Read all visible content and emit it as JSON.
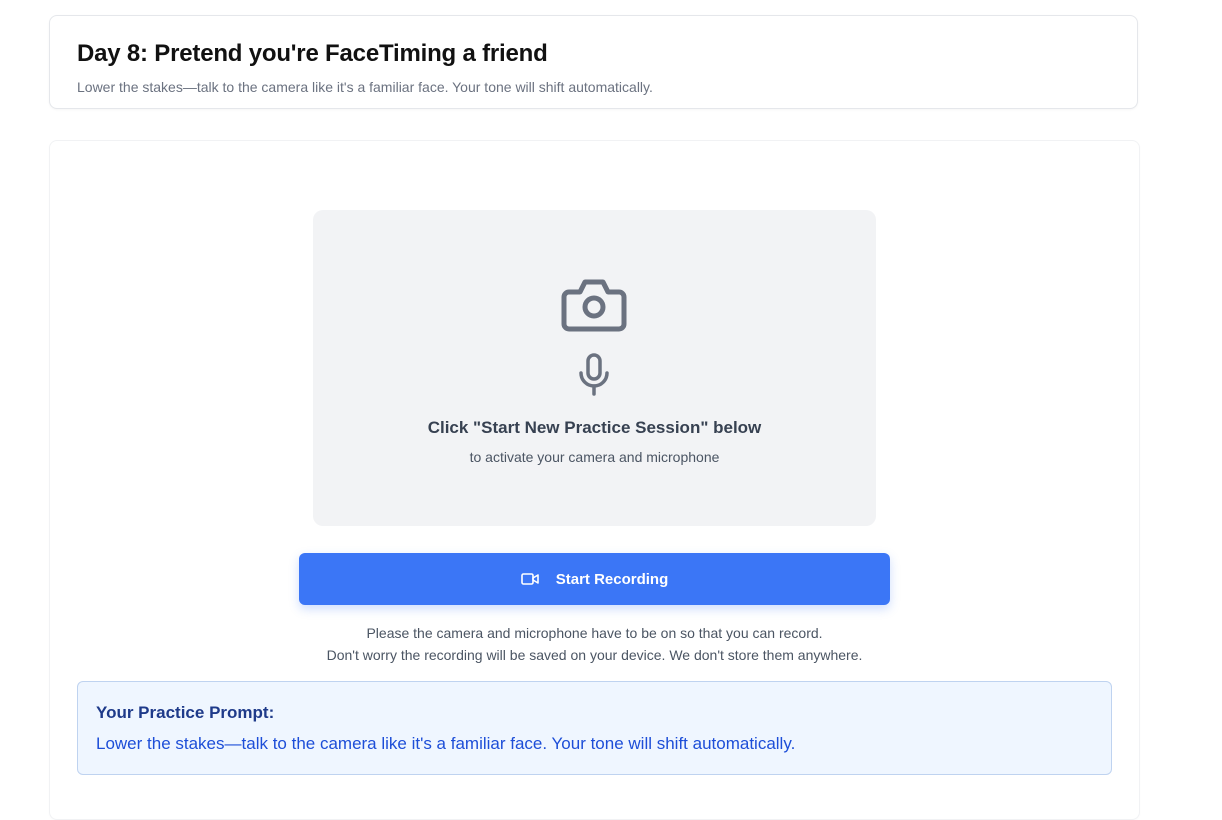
{
  "header": {
    "title": "Day 8: Pretend you're FaceTiming a friend",
    "subtitle": "Lower the stakes—talk to the camera like it's a familiar face. Your tone will shift automatically."
  },
  "preview": {
    "icons": [
      "camera-icon",
      "microphone-icon"
    ],
    "title": "Click \"Start New Practice Session\" below",
    "subtitle": "to activate your camera and microphone"
  },
  "record_button": {
    "icon": "video-camera-icon",
    "label": "Start Recording"
  },
  "notice": {
    "line1": "Please the camera and microphone have to be on so that you can record.",
    "line2": "Don't worry the recording will be saved on your device. We don't store them anywhere."
  },
  "prompt": {
    "label": "Your Practice Prompt:",
    "text": "Lower the stakes—talk to the camera like it's a familiar face. Your tone will shift automatically."
  },
  "colors": {
    "accent": "#3b76f6",
    "preview_bg": "#f2f3f5",
    "icon_gray": "#6b7280",
    "prompt_bg": "#eff6ff",
    "prompt_label": "#1e3a8a",
    "prompt_text": "#1d4ed8"
  }
}
